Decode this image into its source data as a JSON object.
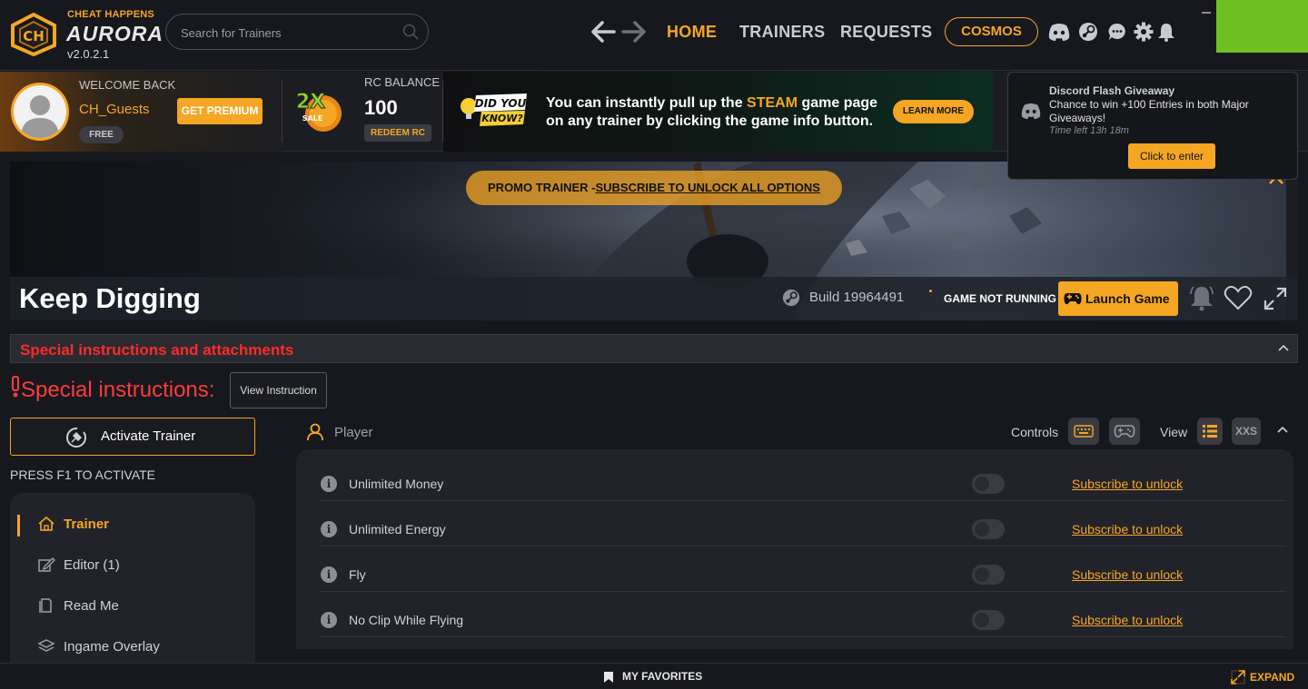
{
  "brand": {
    "company": "CHEAT HAPPENS",
    "product": "AURORA",
    "version": "v2.0.2.1"
  },
  "search": {
    "placeholder": "Search for Trainers"
  },
  "nav": {
    "home": "HOME",
    "trainers": "TRAINERS",
    "requests": "REQUESTS",
    "cosmos": "COSMOS"
  },
  "topicons": [
    "discord-icon",
    "steam-icon",
    "chat-icon",
    "gear-icon",
    "bell-icon"
  ],
  "profile": {
    "welcome": "WELCOME BACK",
    "username": "CH_Guests",
    "tier": "FREE",
    "premium_btn": "GET PREMIUM"
  },
  "sale": {
    "multiplier": "2X",
    "label": "SALE"
  },
  "rc": {
    "label": "RC BALANCE",
    "value": "100",
    "redeem_btn": "REDEEM RC"
  },
  "tip": {
    "badge_line1": "DID YOU",
    "badge_line2": "KNOW?",
    "text_pre": "You can instantly pull up the ",
    "text_highlight": "STEAM",
    "text_post": " game page on any trainer by clicking the game info button.",
    "learn_btn": "LEARN MORE"
  },
  "giveaway": {
    "title": "Discord Flash Giveaway",
    "desc": "Chance to win +100 Entries in both Major Giveaways!",
    "time_left": "Time left 13h 18m",
    "btn": "Click to enter"
  },
  "game": {
    "promo_prefix": "PROMO TRAINER -",
    "promo_link": "SUBSCRIBE TO UNLOCK ALL OPTIONS",
    "title": "Keep Digging",
    "build": "Build 19964491",
    "status": "GAME NOT RUNNING",
    "launch_btn": "Launch Game"
  },
  "instructions": {
    "bar_title": "Special instructions and attachments",
    "heading": "Special instructions:",
    "view_btn": "View Instruction"
  },
  "trainer": {
    "activate_btn": "Activate Trainer",
    "hotkey_hint": "PRESS F1 TO ACTIVATE"
  },
  "sidebar": {
    "items": [
      {
        "label": "Trainer",
        "active": true
      },
      {
        "label": "Editor (1)",
        "active": false
      },
      {
        "label": "Read Me",
        "active": false
      },
      {
        "label": "Ingame Overlay",
        "active": false
      }
    ]
  },
  "panel": {
    "section": "Player",
    "controls_label": "Controls",
    "view_label": "View",
    "xxs_label": "XXS"
  },
  "options": [
    {
      "name": "Unlimited Money",
      "enabled": false,
      "action": "Subscribe to unlock"
    },
    {
      "name": "Unlimited Energy",
      "enabled": false,
      "action": "Subscribe to unlock"
    },
    {
      "name": "Fly",
      "enabled": false,
      "action": "Subscribe to unlock"
    },
    {
      "name": "No Clip While Flying",
      "enabled": false,
      "action": "Subscribe to unlock"
    }
  ],
  "bottom": {
    "favorites": "MY FAVORITES",
    "expand": "EXPAND"
  },
  "colors": {
    "accent": "#f5a623",
    "alert": "#ff2a2a",
    "bg": "#16181e",
    "panel": "#22232a",
    "window_green": "#6dbf22"
  }
}
